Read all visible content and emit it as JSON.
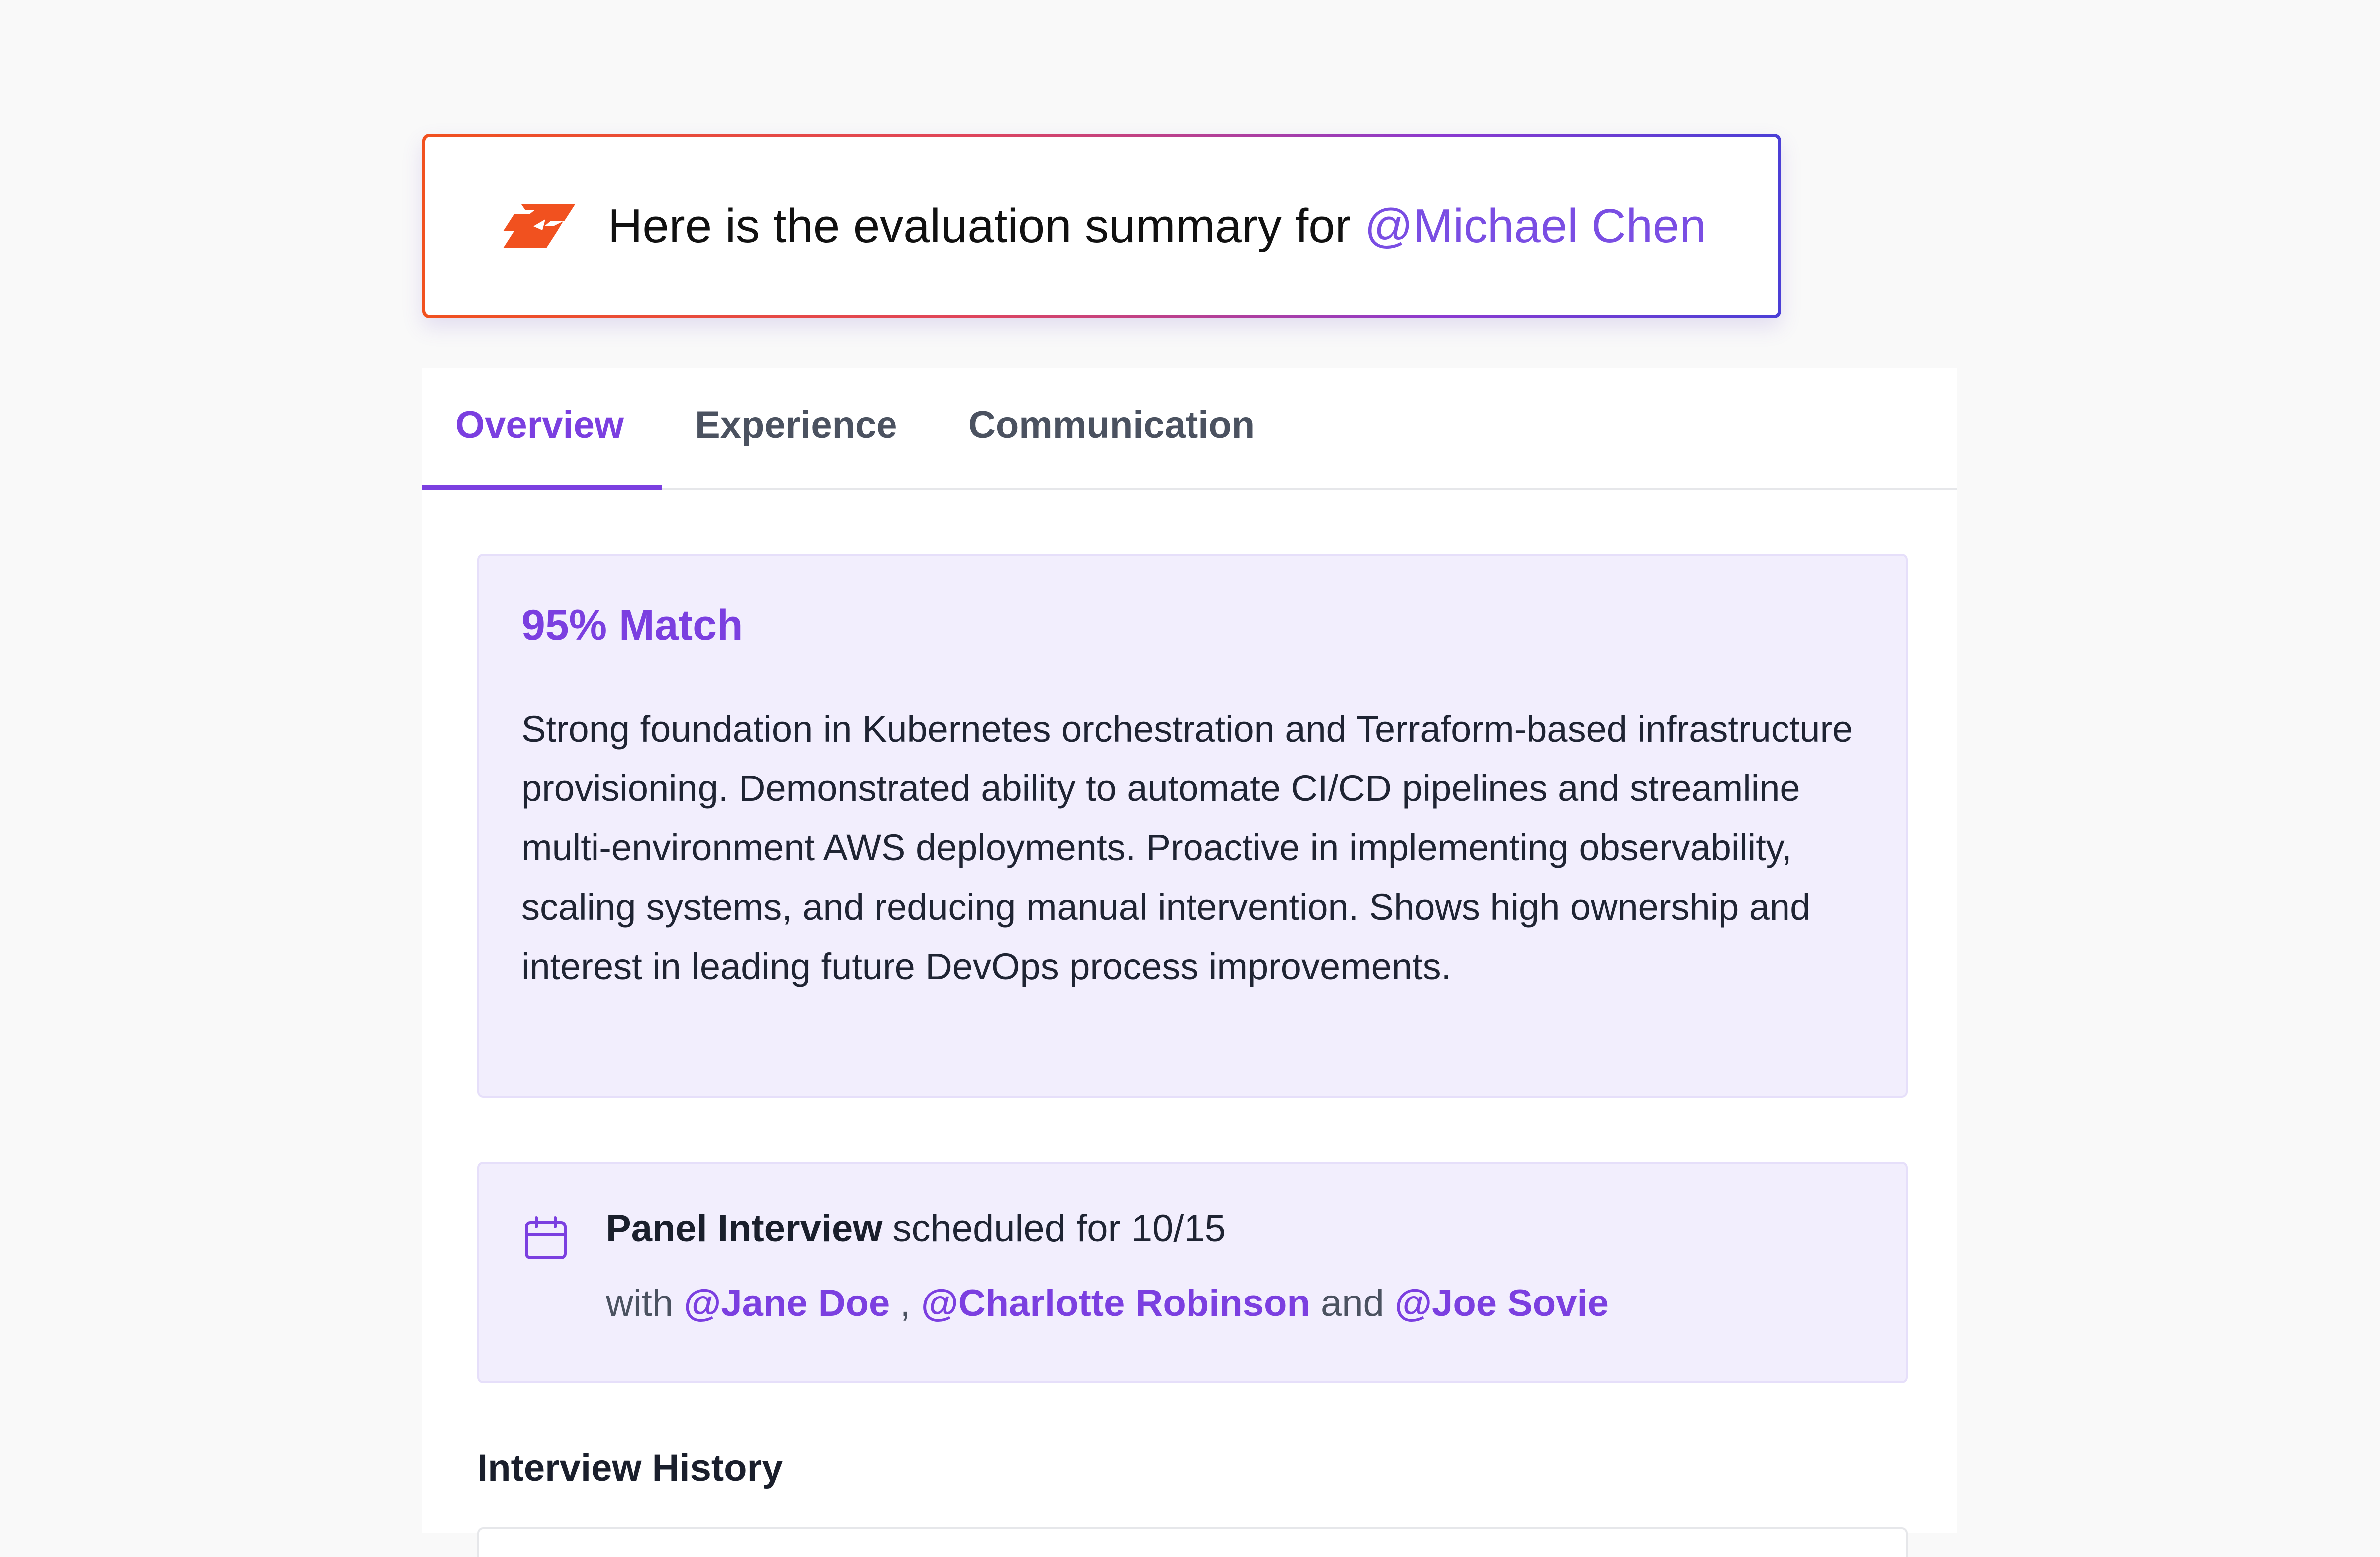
{
  "banner": {
    "text": "Here is the evaluation summary for",
    "mention": "@Michael Chen",
    "logo_icon": "brand-logo-icon",
    "gradient_colors": [
      "#f1511f",
      "#8b3ad0",
      "#4b3fd6"
    ]
  },
  "tabs": [
    {
      "label": "Overview",
      "active": true
    },
    {
      "label": "Experience",
      "active": false
    },
    {
      "label": "Communication",
      "active": false
    }
  ],
  "match": {
    "title": "95% Match",
    "description": "Strong foundation in Kubernetes orchestration and Terraform-based infrastructure provisioning. Demonstrated ability to automate CI/CD pipelines and streamline multi-environment AWS deployments. Proactive in implementing observability, scaling systems, and reducing manual intervention. Shows high ownership and interest in leading future DevOps process improvements."
  },
  "interview": {
    "icon": "calendar-icon",
    "type": "Panel Interview",
    "scheduled_text": "scheduled for 10/15",
    "with_label": "with",
    "separator": ",",
    "and_label": "and",
    "participants": [
      "@Jane Doe",
      "@Charlotte Robinson",
      "@Joe Sovie"
    ]
  },
  "history": {
    "heading": "Interview History"
  },
  "colors": {
    "accent": "#7b3fe0",
    "panel_bg": "#f2eefd",
    "brand_orange": "#f1511f"
  }
}
